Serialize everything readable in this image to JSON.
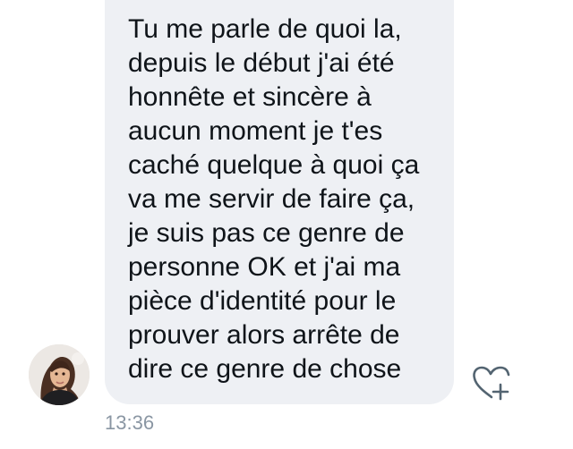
{
  "conversation": {
    "message": {
      "lines": [
        "Tu me parle de quoi la,",
        "depuis le début j'ai été",
        "honnête et sincère à",
        "aucun moment je t'es",
        "caché quelque à quoi ça",
        "va me servir de faire ça,",
        "je suis pas ce genre de",
        "personne OK et j'ai ma",
        "pièce d'identité pour le",
        "prouver alors arrête de",
        "dire ce genre de chose"
      ],
      "timestamp": "13:36"
    },
    "icons": {
      "avatar": "sender-avatar",
      "reaction": "heart-plus-icon"
    },
    "colors": {
      "bubble": "#eef0f4",
      "text": "#0f1419",
      "timestamp": "#8a96a3",
      "icon": "#536471"
    }
  }
}
